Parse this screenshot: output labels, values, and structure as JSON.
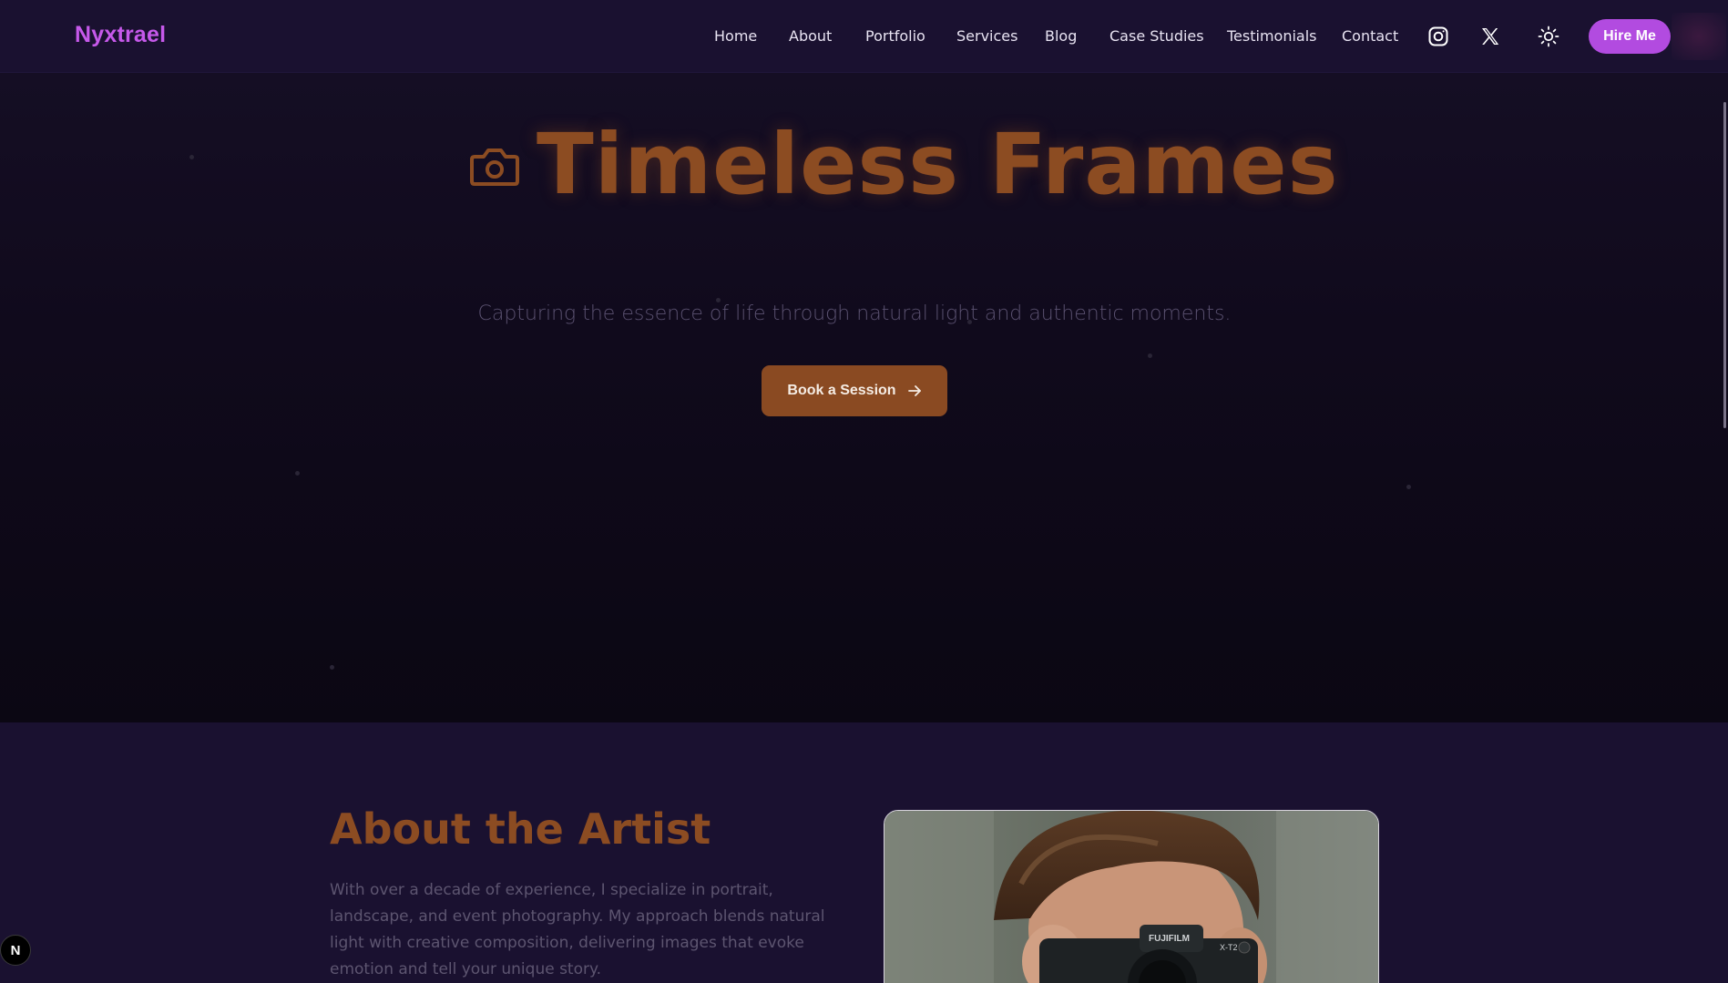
{
  "nav": {
    "brand": "Nyxtrael",
    "links": [
      "Home",
      "About",
      "Portfolio",
      "Services",
      "Blog",
      "Case Studies",
      "Testimonials",
      "Contact"
    ],
    "hire_label": "Hire Me",
    "icons": [
      "instagram-icon",
      "x-twitter-icon",
      "sun-icon"
    ]
  },
  "hero": {
    "title": "Timeless Frames",
    "subtitle": "Capturing the essence of life through natural light and authentic moments.",
    "cta_label": "Book a Session"
  },
  "about": {
    "title": "About the Artist",
    "text": "With over a decade of experience, I specialize in portrait, landscape, and event photography. My approach blends natural light with creative composition, delivering images that evoke emotion and tell your unique story."
  },
  "badge": {
    "label": "N"
  },
  "colors": {
    "accent_purple": "#b24be0",
    "brand_purple": "#c659ea",
    "accent_orange": "#8c4c22",
    "nav_bg": "#1a1130"
  }
}
